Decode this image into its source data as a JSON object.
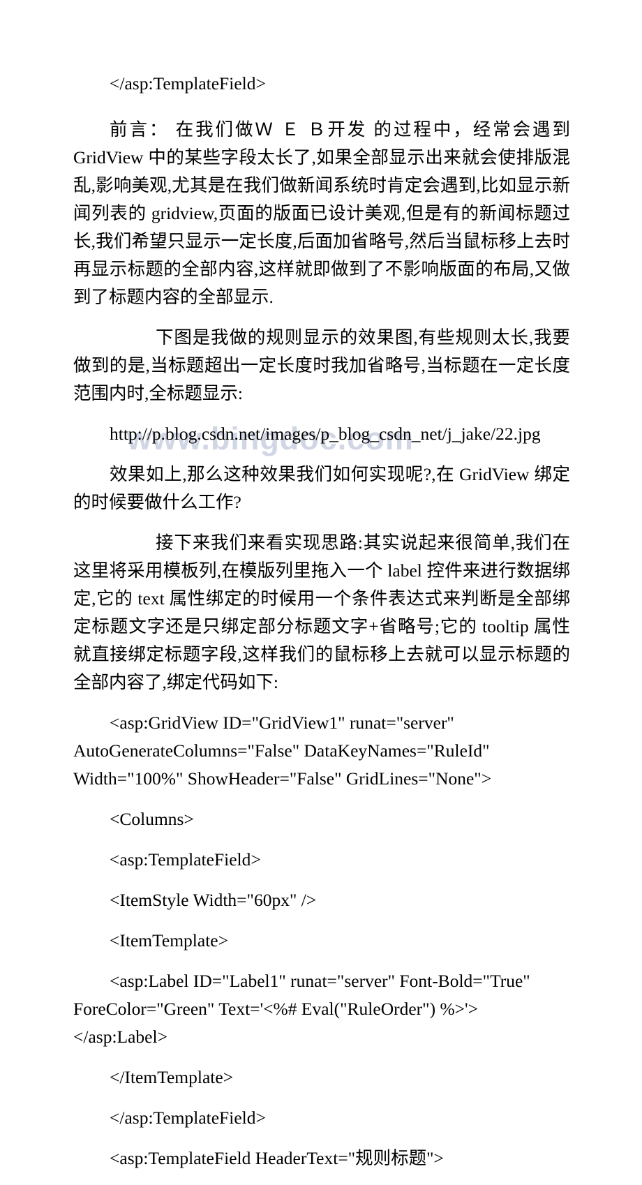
{
  "document": {
    "watermark": "www.bingdoc.com",
    "body": [
      {
        "id": "line-close-templatefield-top",
        "kind": "code",
        "text": "</asp:TemplateField>"
      },
      {
        "id": "para-foreword",
        "kind": "paragraph",
        "indent": 2,
        "text": "前言： 在我们做Ｗ Ｅ Ｂ开发 的过程中，经常会遇到 GridView 中的某些字段太长了,如果全部显示出来就会使排版混乱,影响美观,尤其是在我们做新闻系统时肯定会遇到,比如显示新闻列表的 gridview,页面的版面已设计美观,但是有的新闻标题过长,我们希望只显示一定长度,后面加省略号,然后当鼠标移上去时再显示标题的全部内容,这样就即做到了不影响版面的布局,又做到了标题内容的全部显示."
      },
      {
        "id": "para-effect-description",
        "kind": "paragraph",
        "indent": 4,
        "text": "下图是我做的规则显示的效果图,有些规则太长,我要做到的是,当标题超出一定长度时我加省略号,当标题在一定长度范围内时,全标题显示:"
      },
      {
        "id": "line-image-url",
        "kind": "url",
        "text": "http://p.blog.csdn.net/images/p_blog_csdn_net/j_jake/22.jpg"
      },
      {
        "id": "para-how-to-implement",
        "kind": "paragraph",
        "indent": 2,
        "text": "效果如上,那么这种效果我们如何实现呢?,在 GridView 绑定的时候要做什么工作?"
      },
      {
        "id": "para-implementation-idea",
        "kind": "paragraph",
        "indent": 4,
        "text": "接下来我们来看实现思路:其实说起来很简单,我们在这里将采用模板列,在模版列里拖入一个 label 控件来进行数据绑定,它的 text 属性绑定的时候用一个条件表达式来判断是全部绑定标题文字还是只绑定部分标题文字+省略号;它的 tooltip 属性就直接绑定标题字段,这样我们的鼠标移上去就可以显示标题的全部内容了,绑定代码如下:"
      },
      {
        "id": "line-gridview-open",
        "kind": "code",
        "text": "<asp:GridView ID=\"GridView1\" runat=\"server\" AutoGenerateColumns=\"False\" DataKeyNames=\"RuleId\" Width=\"100%\" ShowHeader=\"False\" GridLines=\"None\">"
      },
      {
        "id": "line-columns-open",
        "kind": "code",
        "text": "<Columns>"
      },
      {
        "id": "line-templatefield-open",
        "kind": "code",
        "text": "<asp:TemplateField>"
      },
      {
        "id": "line-itemstyle",
        "kind": "code",
        "text": "<ItemStyle Width=\"60px\" />"
      },
      {
        "id": "line-itemtemplate-open",
        "kind": "code",
        "text": "<ItemTemplate>"
      },
      {
        "id": "line-label",
        "kind": "code",
        "text": "<asp:Label ID=\"Label1\" runat=\"server\" Font-Bold=\"True\" ForeColor=\"Green\" Text='<%# Eval(\"RuleOrder\") %>'></asp:Label>"
      },
      {
        "id": "line-itemtemplate-close",
        "kind": "code",
        "text": "</ItemTemplate>"
      },
      {
        "id": "line-templatefield-close",
        "kind": "code",
        "text": "</asp:TemplateField>"
      },
      {
        "id": "line-templatefield-headertext",
        "kind": "code",
        "text": "<asp:TemplateField HeaderText=\"规则标题\">"
      }
    ]
  }
}
